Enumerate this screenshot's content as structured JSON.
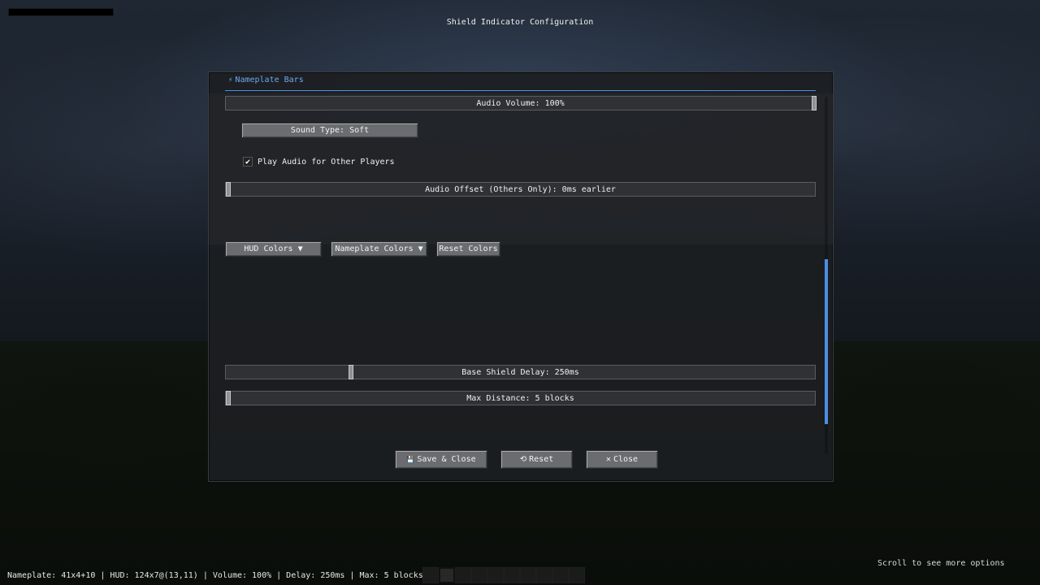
{
  "screen": {
    "title": "Shield Indicator Configuration"
  },
  "tabs": [
    {
      "icon": "⚡",
      "label": "Nameplate Bars",
      "active": true
    }
  ],
  "controls": {
    "audio_volume": {
      "label": "Audio Volume: 100%",
      "value": 1.0
    },
    "sound_type": {
      "label": "Sound Type: Soft"
    },
    "play_audio_others": {
      "label": "Play Audio for Other Players",
      "checked": true,
      "check_glyph": "✔"
    },
    "audio_offset": {
      "label": "Audio Offset (Others Only): 0ms earlier",
      "value": 0.0
    },
    "hud_colors": {
      "label": "HUD Colors ▼"
    },
    "nameplate_colors": {
      "label": "Nameplate Colors ▼"
    },
    "reset_colors": {
      "label": "Reset Colors"
    },
    "base_shield_delay": {
      "label": "Base Shield Delay: 250ms",
      "value": 0.21
    },
    "max_distance": {
      "label": "Max Distance: 5 blocks",
      "value": 0.0
    }
  },
  "footer": {
    "save_close": {
      "icon": "💾",
      "label": "Save & Close"
    },
    "reset": {
      "icon": "⟲",
      "label": "Reset"
    },
    "close": {
      "icon": "✕",
      "label": "Close"
    }
  },
  "status_bar": {
    "text": "Nameplate: 41x4+10 | HUD: 124x7@(13,11) | Volume: 100% | Delay: 250ms | Max: 5 blocks"
  },
  "hint": {
    "text": "Scroll to see more options"
  },
  "hotbar": {
    "slot_count": 10,
    "selected_index": 1
  },
  "colors": {
    "accent": "#4a90e2",
    "tab_text": "#6fa8ee"
  }
}
